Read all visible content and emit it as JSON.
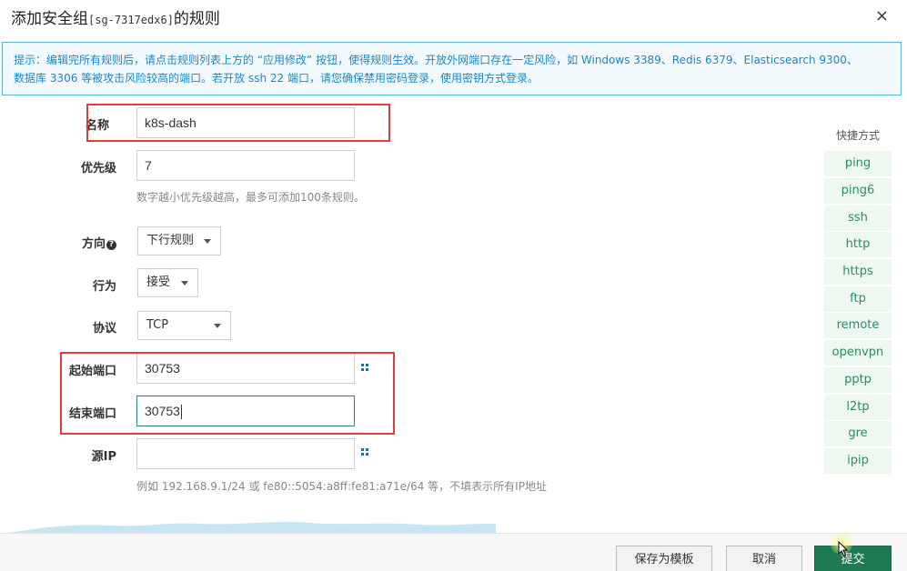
{
  "dialog": {
    "title_prefix": "添加安全组",
    "title_sgid": "[sg-7317edx6]",
    "title_suffix": "的规则",
    "close": "×"
  },
  "tip": {
    "line1": "提示：编辑完所有规则后，请点击规则列表上方的 “应用修改” 按钮，使得规则生效。开放外网端口存在一定风险，如 Windows 3389、Redis 6379、Elasticsearch 9300、",
    "line2": "数据库 3306 等被攻击风险较高的端口。若开放 ssh 22 端口，请您确保禁用密码登录，使用密钥方式登录。"
  },
  "form": {
    "name": {
      "label": "名称",
      "value": "k8s-dash"
    },
    "priority": {
      "label": "优先级",
      "value": "7",
      "help": "数字越小优先级越高，最多可添加100条规则。"
    },
    "direction": {
      "label": "方向",
      "value": "下行规则"
    },
    "action": {
      "label": "行为",
      "value": "接受"
    },
    "protocol": {
      "label": "协议",
      "value": "TCP"
    },
    "start_port": {
      "label": "起始端口",
      "value": "30753"
    },
    "end_port": {
      "label": "结束端口",
      "value": "30753"
    },
    "source_ip": {
      "label": "源IP",
      "value": "",
      "help": "例如 192.168.9.1/24 或 fe80::5054:a8ff:fe81:a71e/64 等，不填表示所有IP地址"
    }
  },
  "shortcuts": {
    "title": "快捷方式",
    "items": [
      "ping",
      "ping6",
      "ssh",
      "http",
      "https",
      "ftp",
      "remote",
      "openvpn",
      "pptp",
      "l2tp",
      "gre",
      "ipip"
    ]
  },
  "footer": {
    "save_template": "保存为模板",
    "cancel": "取消",
    "submit": "提交"
  },
  "colors": {
    "highlight": "#e03c3c",
    "primary": "#1f7a53",
    "shortcut_text": "#2d8d5c",
    "tip_text": "#1b86c6"
  }
}
